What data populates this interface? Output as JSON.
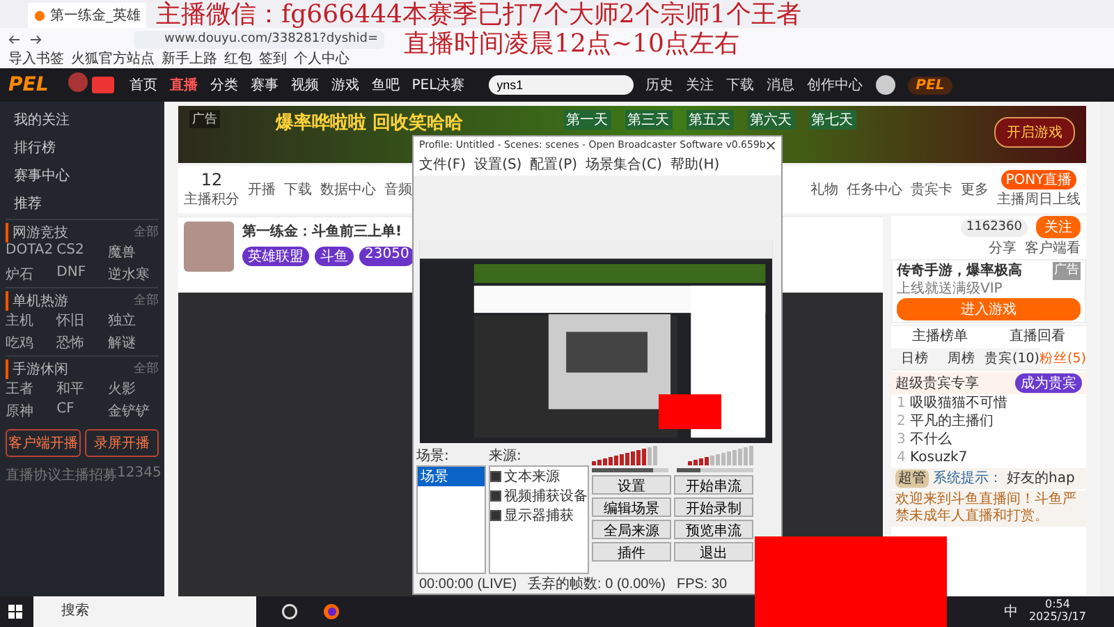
{
  "overlay_text": [
    "主播微信：fg666444本赛季已打7个大师2个宗师1个王者",
    "直播时间凌晨12点~10点左右"
  ],
  "browser": {
    "tab_title": "第一练金_英雄",
    "url": "www.douyu.com/338281?dyshid=",
    "bookmarks": [
      "导入书签",
      "火狐官方站点",
      "新手上路",
      "红包",
      "签到",
      "个人中心"
    ]
  },
  "header": {
    "logo_text": "PEL",
    "nav": [
      {
        "label": "首页",
        "selected": false
      },
      {
        "label": "直播",
        "selected": true
      },
      {
        "label": "分类",
        "selected": false
      },
      {
        "label": "赛事",
        "selected": false
      },
      {
        "label": "视频",
        "selected": false
      },
      {
        "label": "游戏",
        "selected": false
      },
      {
        "label": "鱼吧",
        "selected": false
      },
      {
        "label": "PEL决赛",
        "selected": false
      }
    ],
    "search": {
      "value": "yns1"
    },
    "actions": [
      "历史",
      "关注",
      "下载",
      "消息",
      "创作中心"
    ],
    "badge_text": "PEL"
  },
  "sidebar": {
    "items": [
      "我的关注",
      "排行榜",
      "赛事中心",
      "推荐"
    ],
    "sections": [
      {
        "title": "网游竞技",
        "more": "全部",
        "items": [
          "DOTA2",
          "CS2",
          "魔兽",
          "炉石",
          "DNF",
          "逆水寒"
        ]
      },
      {
        "title": "单机热游",
        "more": "全部",
        "items": [
          "主机",
          "怀旧",
          "独立",
          "吃鸡",
          "恐怖",
          "解谜"
        ]
      },
      {
        "title": "手游休闲",
        "more": "全部",
        "items": [
          "王者",
          "和平",
          "火影",
          "原神",
          "CF",
          "金铲铲"
        ]
      }
    ],
    "buttons": [
      "客户端开播",
      "录屏开播"
    ],
    "footer": [
      "直播协议",
      "主播招募",
      "12345"
    ]
  },
  "banner": {
    "headline": "爆率哗啦啦 回收笑哈哈",
    "ad_label": "广告",
    "days": [
      "第一天",
      "第三天",
      "第五天",
      "第六天",
      "第七天"
    ],
    "cta": "开启游戏"
  },
  "info_bar": {
    "count": "12",
    "count_label": "主播积分",
    "tools_left": [
      "开播",
      "下载",
      "数据中心",
      "音频"
    ],
    "tools_right": [
      "礼物",
      "任务中心",
      "贵宾卡",
      "更多"
    ],
    "pony": "PONY直播",
    "pony_sub": "主播周日上线"
  },
  "streamer": {
    "title": "第一练金：斗鱼前三上单!",
    "tags": [
      "英雄联盟",
      "斗鱼",
      "23050"
    ],
    "followers": "1162360",
    "follow": "关注",
    "share": "分享",
    "client": "客户端看"
  },
  "right": {
    "ad_title": "传奇手游，爆率极高",
    "ad_sub": "上线就送满级VIP",
    "ad_button": "进入游戏",
    "ad_label": "广告",
    "tabs": [
      {
        "label": "主播榜单"
      },
      {
        "label": "直播回看"
      }
    ],
    "rank_tabs": [
      {
        "label": "日榜",
        "selected": false
      },
      {
        "label": "周榜",
        "selected": false
      },
      {
        "label": "贵宾(10)",
        "selected": false
      },
      {
        "label": "粉丝(5)",
        "selected": true
      }
    ],
    "vip_text": "超级贵宾专享",
    "vip_button": "成为贵宾",
    "ranks": [
      {
        "num": "1",
        "name": "吸吸猫猫不可惜"
      },
      {
        "num": "2",
        "name": "平凡的主播们"
      },
      {
        "num": "3",
        "name": "不什么"
      },
      {
        "num": "4",
        "name": "Kosuzk7"
      }
    ],
    "chat": [
      {
        "tag": "超管",
        "name": "系统提示：",
        "text": "好友的hap"
      }
    ],
    "notice": "欢迎来到斗鱼直播间！斗鱼严禁未成年人直播和打赏。"
  },
  "obs": {
    "title": "Profile: Untitled - Scenes: scenes - Open Broadcaster Software v0.659b",
    "menu": [
      "文件(F)",
      "设置(S)",
      "配置(P)",
      "场景集合(C)",
      "帮助(H)"
    ],
    "scenes_label": "场景:",
    "scenes": [
      {
        "label": "场景",
        "selected": true
      }
    ],
    "sources_label": "来源:",
    "sources": [
      {
        "label": "文本来源",
        "checked": true
      },
      {
        "label": "视频捕获设备",
        "checked": true
      },
      {
        "label": "显示器捕获",
        "checked": true
      }
    ],
    "mic": {
      "level": 0.8
    },
    "desktop": {
      "level": 0.3
    },
    "buttons": [
      "设置",
      "开始串流",
      "编辑场景",
      "开始录制",
      "全局来源",
      "预览串流",
      "插件",
      "退出"
    ],
    "status": [
      "00:00:00 (LIVE)",
      "丢弃的帧数: 0 (0.00%)",
      "FPS: 30"
    ]
  },
  "taskbar": {
    "search": "搜索",
    "tray_text": "中",
    "time": "0:54",
    "date": "2025/3/17"
  }
}
